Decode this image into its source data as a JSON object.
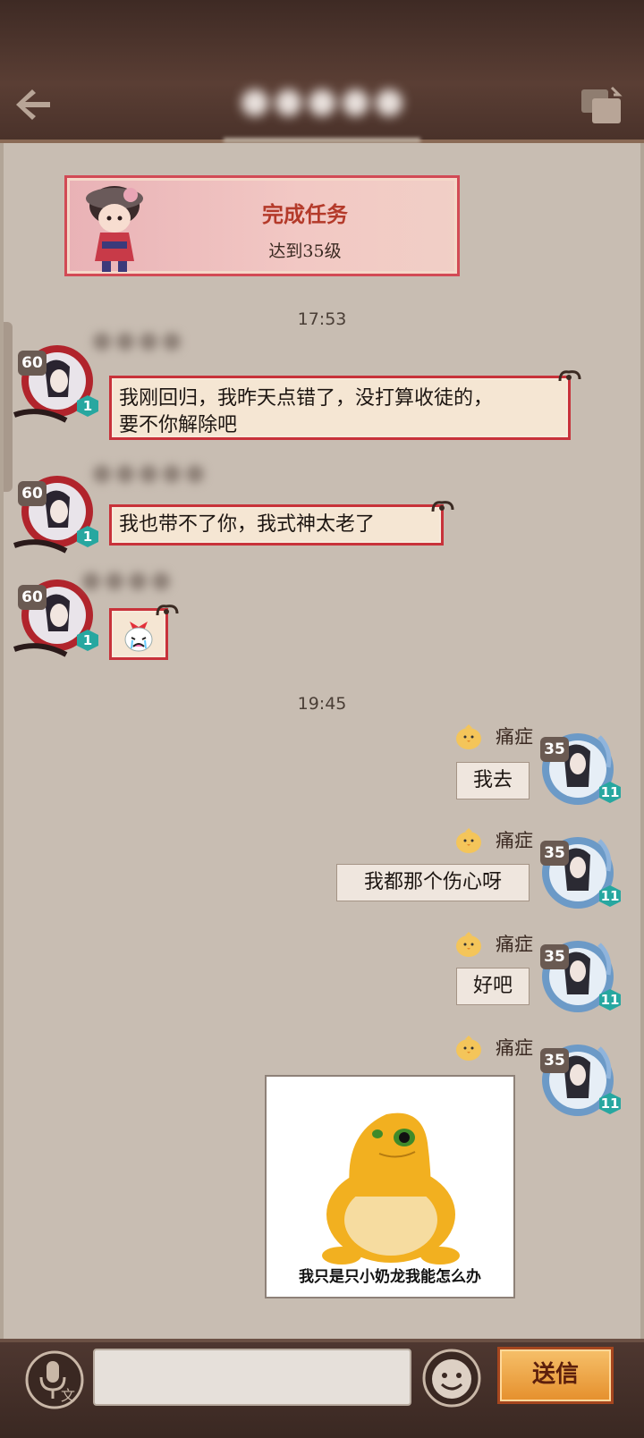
{
  "header": {
    "back_icon": "back-arrow-icon",
    "switch_icon": "switch-window-icon"
  },
  "task_card": {
    "title": "完成任务",
    "subtitle": "达到35级"
  },
  "timestamps": [
    "17:53",
    "19:45"
  ],
  "incoming": [
    {
      "level": "60",
      "badge": "1",
      "text_lines": [
        "我刚回归，我昨天点错了，没打算收徒的，",
        "要不你解除吧"
      ]
    },
    {
      "level": "60",
      "badge": "1",
      "text": "我也带不了你，我式神太老了"
    },
    {
      "level": "60",
      "badge": "1",
      "sticker": "crying-face-sticker"
    }
  ],
  "outgoing": [
    {
      "name": "痛症",
      "level": "35",
      "badge": "11",
      "text": "我去"
    },
    {
      "name": "痛症",
      "level": "35",
      "badge": "11",
      "text": "我都那个伤心呀"
    },
    {
      "name": "痛症",
      "level": "35",
      "badge": "11",
      "text": "好吧"
    },
    {
      "name": "痛症",
      "level": "35",
      "badge": "11",
      "meme_caption": "我只是只小奶龙我能怎么办"
    }
  ],
  "input_bar": {
    "send_label": "送信",
    "voice_icon": "voice-to-text-icon",
    "emoji_icon": "emoji-face-icon"
  },
  "colors": {
    "accent_red": "#c8323a",
    "send_orange": "#e58f2c",
    "header_brown": "#4a322a"
  }
}
